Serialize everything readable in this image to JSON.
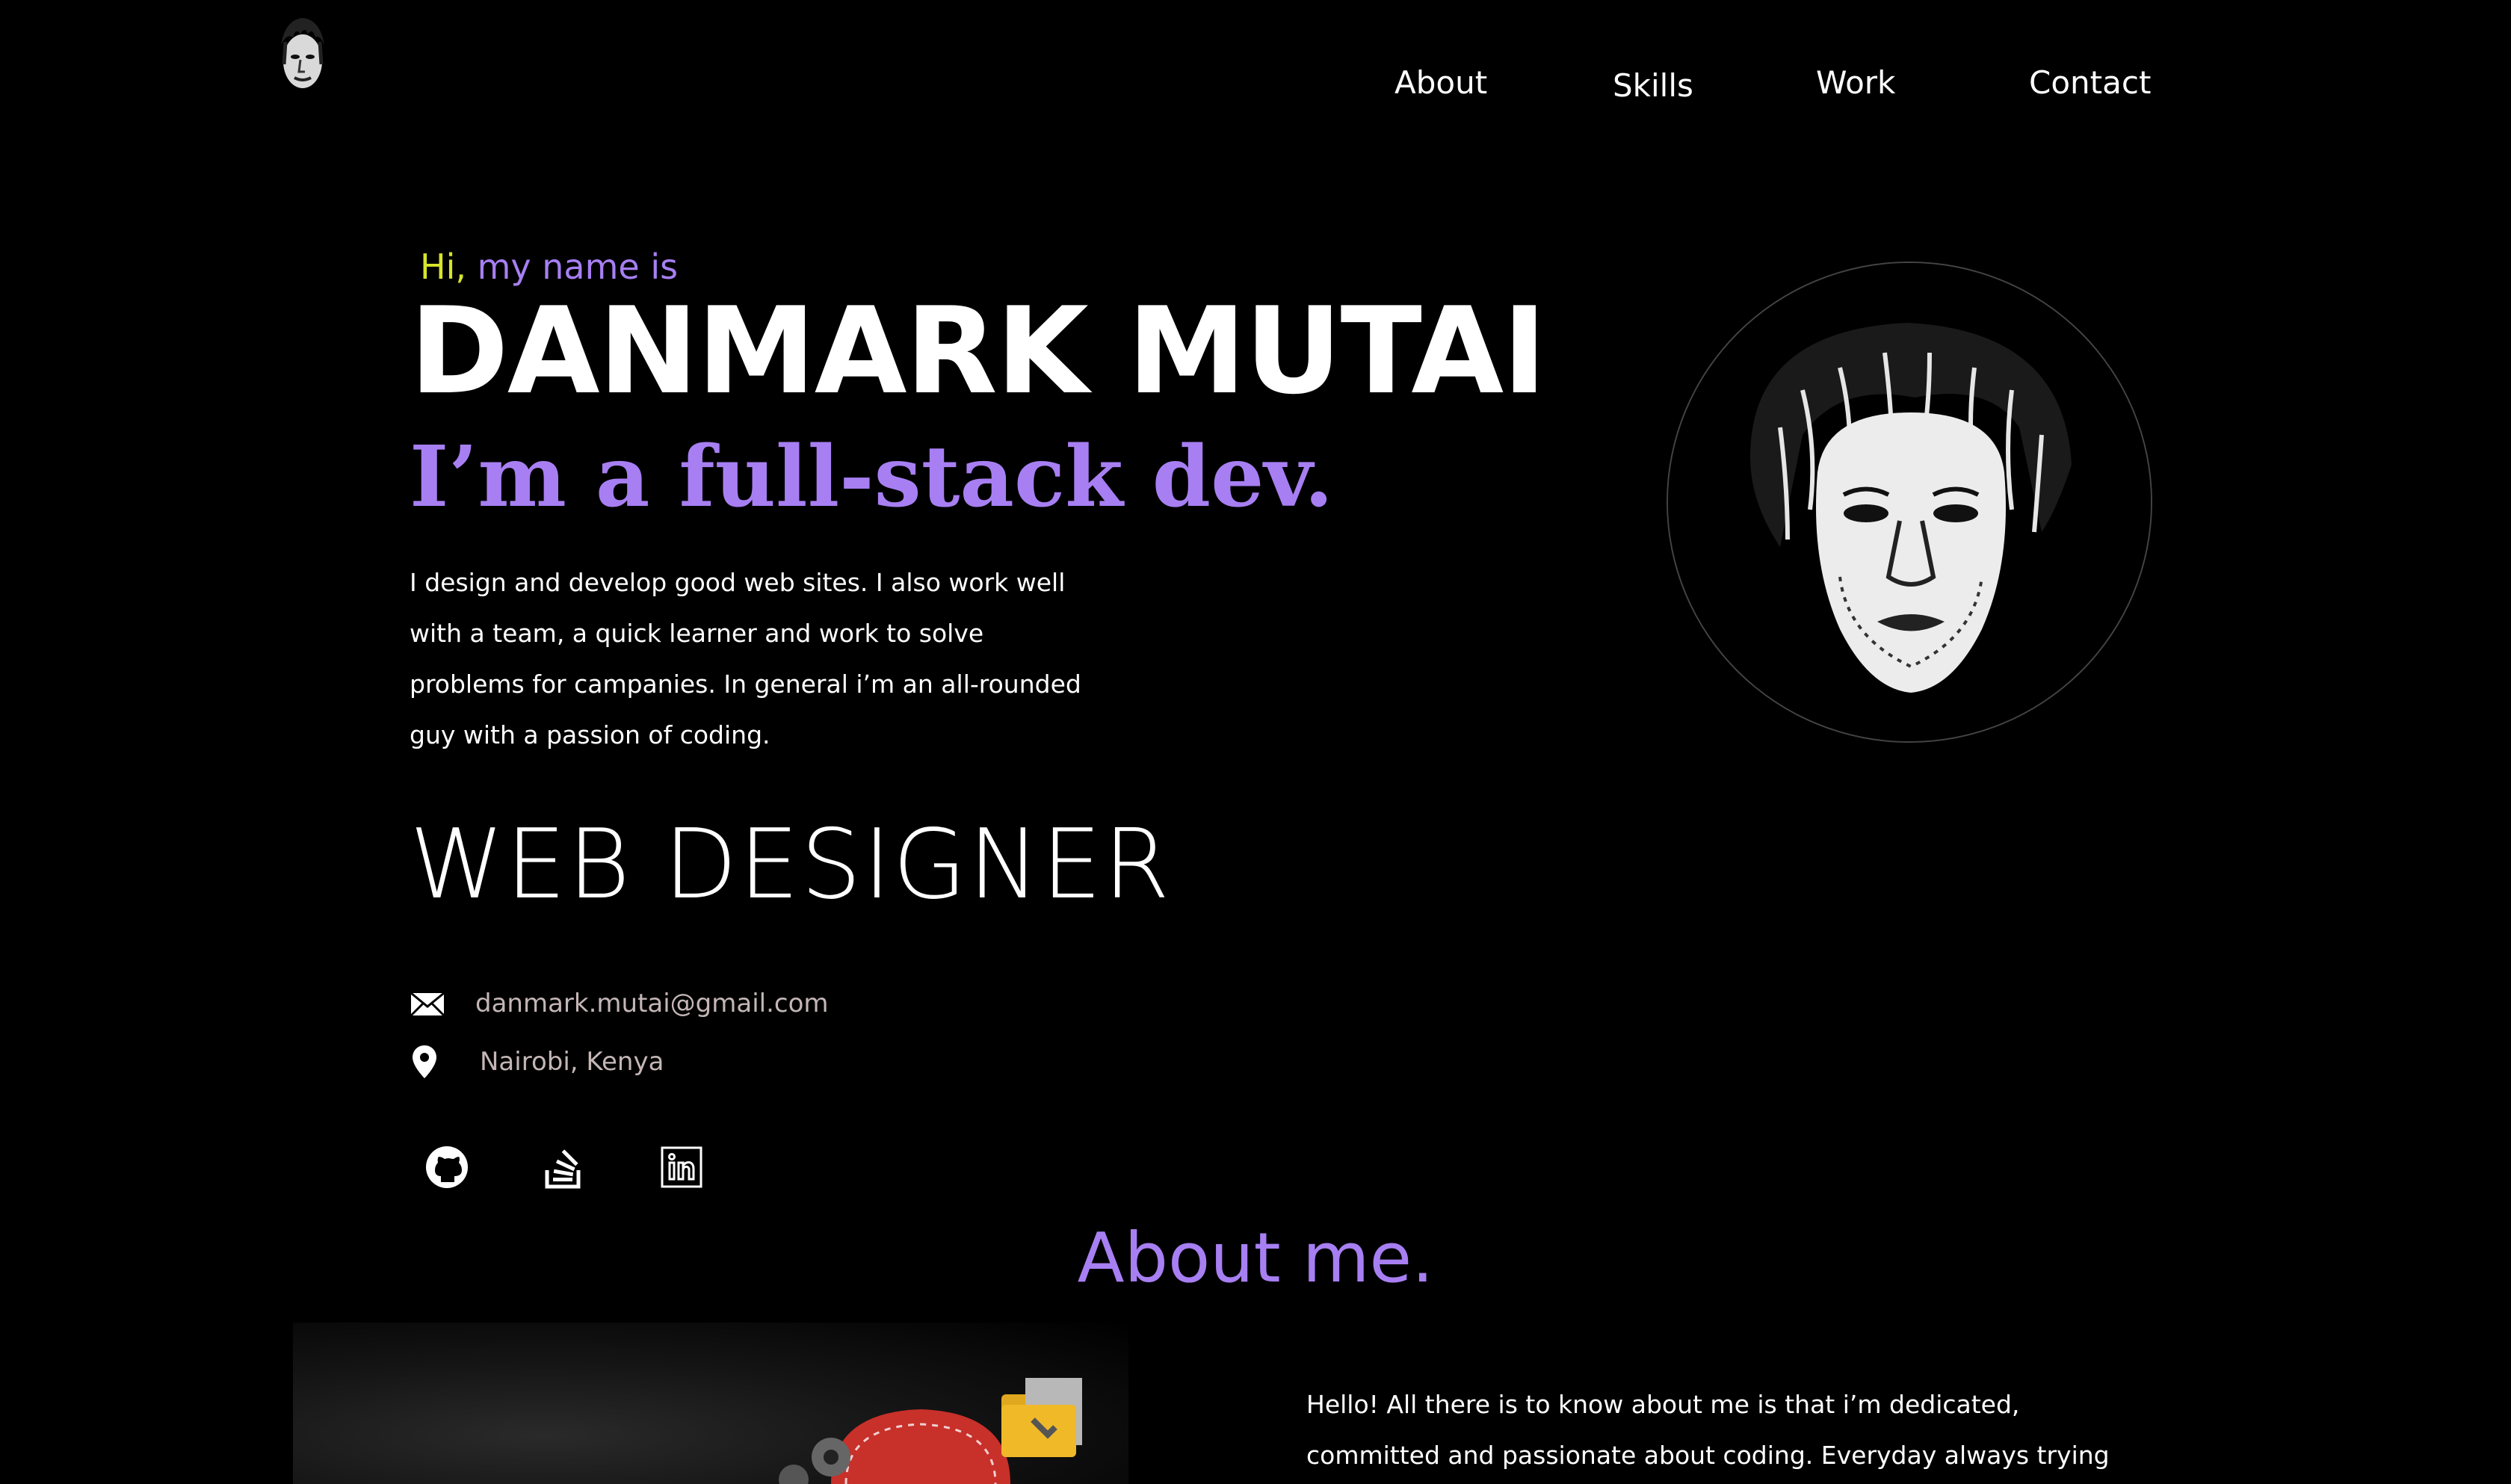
{
  "nav": {
    "about": "About",
    "skills": "Skills",
    "work": "Work",
    "contact": "Contact"
  },
  "hero": {
    "greeting_hi": "Hi,",
    "greeting_rest": "my name is",
    "name": "DANMARK MUTAI",
    "tagline": "I’m a full-stack dev.",
    "bio": "I design and develop good web sites. I also work well with a team, a quick learner and work to solve problems for campanies. In general i’m an all-rounded guy with a passion of coding.",
    "role": "WEB DESIGNER"
  },
  "contact": {
    "email": "danmark.mutai@gmail.com",
    "location": "Nairobi, Kenya"
  },
  "social": {
    "icons": [
      "github-icon",
      "stackoverflow-icon",
      "linkedin-icon"
    ]
  },
  "about": {
    "title": "About me.",
    "text": "Hello! All there is to know about me is that i’m dedicated, committed and passionate about coding. Everyday always trying to"
  },
  "colors": {
    "background": "#000000",
    "accent": "#a77ff2",
    "greeting_hi": "#d7e52b",
    "muted_text": "#c4b6b6"
  }
}
